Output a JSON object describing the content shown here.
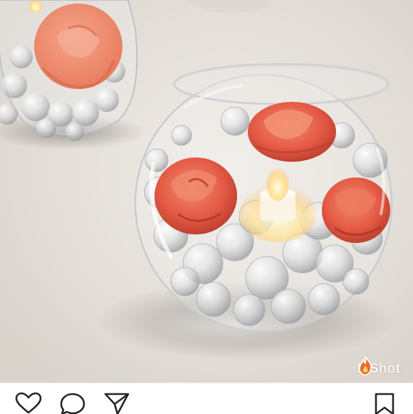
{
  "photo": {
    "description_icon": "photo",
    "watermark": {
      "text": "InShot",
      "logo_icon": "flame-icon"
    }
  },
  "actions": {
    "like_icon": "heart-icon",
    "comment_icon": "comment-bubble-icon",
    "share_icon": "paper-plane-icon",
    "save_icon": "bookmark-icon"
  },
  "colors": {
    "rose": "#e8604a",
    "rose_dark": "#c23f2c",
    "glass": "#ffffff",
    "icon": "#262626"
  }
}
